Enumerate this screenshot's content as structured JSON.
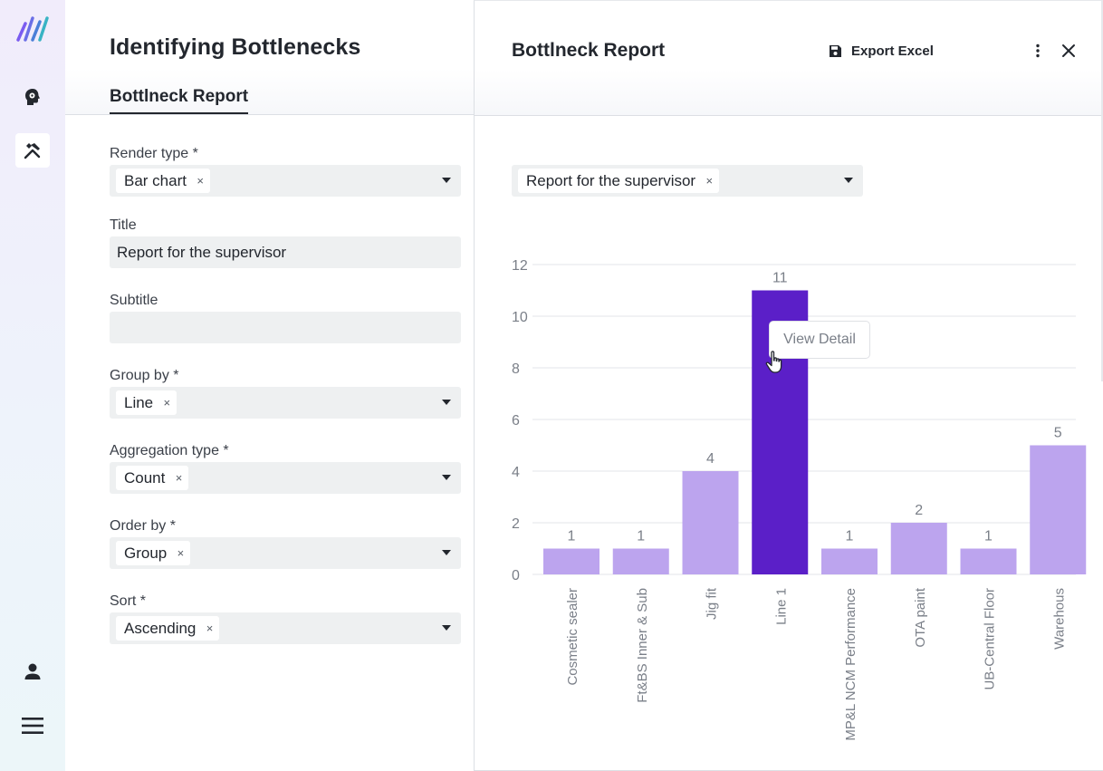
{
  "rail": {
    "items": [
      {
        "name": "logo",
        "icon": "brand-logo"
      },
      {
        "name": "ai-brain",
        "icon": "brain-gear-icon"
      },
      {
        "name": "tools",
        "icon": "tools-icon",
        "active": true
      },
      {
        "name": "account",
        "icon": "person-icon"
      },
      {
        "name": "menu",
        "icon": "hamburger-icon"
      }
    ]
  },
  "left": {
    "page_title": "Identifying Bottlenecks",
    "tab_label": "Bottlneck Report",
    "fields": {
      "render_type": {
        "label": "Render type *",
        "value": "Bar chart"
      },
      "title": {
        "label": "Title",
        "value": "Report for the supervisor"
      },
      "subtitle": {
        "label": "Subtitle",
        "value": ""
      },
      "group_by": {
        "label": "Group by *",
        "value": "Line"
      },
      "aggregation_type": {
        "label": "Aggregation type *",
        "value": "Count"
      },
      "order_by": {
        "label": "Order by *",
        "value": "Group"
      },
      "sort": {
        "label": "Sort *",
        "value": "Ascending"
      }
    },
    "chip_remove": "×"
  },
  "right": {
    "title": "Bottlneck Report",
    "export_label": "Export Excel",
    "report_select_value": "Report for the supervisor",
    "tooltip": "View Detail"
  },
  "colors": {
    "bar": "#bca4ee",
    "bar_active": "#5b1fc8",
    "grid": "#e3e5e8",
    "axis_text": "#7a7f88",
    "logo_a": "#7b5cf0",
    "logo_b": "#4a7fd8",
    "logo_c": "#39b3c4"
  },
  "chart_data": {
    "type": "bar",
    "categories": [
      "Cosmetic sealer",
      "Ft&BS Inner & Sub",
      "Jig fit",
      "Line 1",
      "MP&L NCM Performance",
      "OTA paint",
      "UB-Central Floor",
      "Warehous"
    ],
    "values": [
      1,
      1,
      4,
      11,
      1,
      2,
      1,
      5
    ],
    "highlighted_category": "Line 1",
    "y_ticks": [
      0,
      2,
      4,
      6,
      8,
      10,
      12
    ],
    "ylim": [
      0,
      12
    ],
    "grid": true,
    "data_labels": true
  }
}
